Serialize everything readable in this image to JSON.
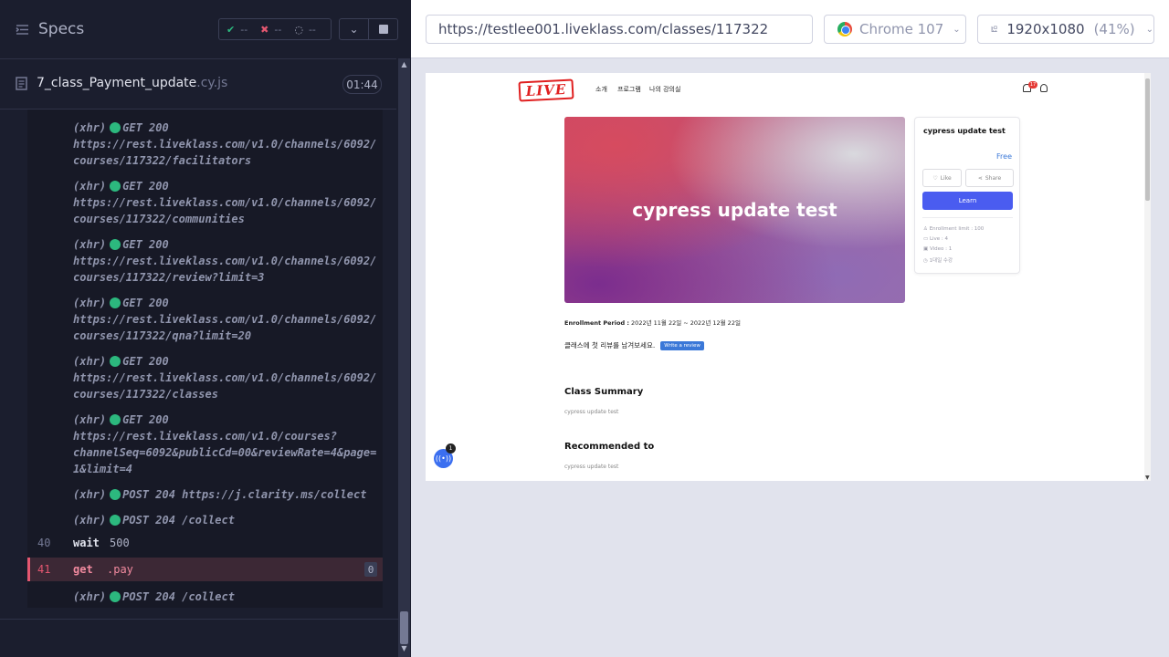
{
  "reporter": {
    "specs_label": "Specs",
    "stats": {
      "passed": "--",
      "failed": "--",
      "pending": "--"
    },
    "spec_file": {
      "name": "7_class_Payment_update",
      "ext": ".cy.js",
      "duration": "01:44"
    },
    "log_entries": [
      {
        "type": "(xhr)",
        "text": "GET 200",
        "url": "https://rest.liveklass.com/v1.0/channels/6092/courses/117322/facilitators",
        "lines": [
          "https://rest.liveklass.com/v1.0/channels/6092/",
          "courses/117322/facilitators"
        ]
      },
      {
        "type": "(xhr)",
        "text": "GET 200",
        "url": "https://rest.liveklass.com/v1.0/channels/6092/courses/117322/communities",
        "lines": [
          "https://rest.liveklass.com/v1.0/channels/6092/",
          "courses/117322/communities"
        ]
      },
      {
        "type": "(xhr)",
        "text": "GET 200",
        "url": "https://rest.liveklass.com/v1.0/channels/6092/courses/117322/review?limit=3",
        "lines": [
          "https://rest.liveklass.com/v1.0/channels/6092/",
          "courses/117322/review?limit=3"
        ]
      },
      {
        "type": "(xhr)",
        "text": "GET 200",
        "url": "https://rest.liveklass.com/v1.0/channels/6092/courses/117322/qna?limit=20",
        "lines": [
          "https://rest.liveklass.com/v1.0/channels/6092/",
          "courses/117322/qna?limit=20"
        ]
      },
      {
        "type": "(xhr)",
        "text": "GET 200",
        "url": "https://rest.liveklass.com/v1.0/channels/6092/courses/117322/classes",
        "lines": [
          "https://rest.liveklass.com/v1.0/channels/6092/",
          "courses/117322/classes"
        ]
      },
      {
        "type": "(xhr)",
        "text": "GET 200",
        "url": "https://rest.liveklass.com/v1.0/courses?channelSeq=6092&publicCd=00&reviewRate=4&page=1&limit=4",
        "lines": [
          "https://rest.liveklass.com/v1.0/courses?",
          "channelSeq=6092&publicCd=00&reviewRate=4&page=",
          "1&limit=4"
        ]
      },
      {
        "type": "(xhr)",
        "text": "POST 204 https://j.clarity.ms/collect"
      },
      {
        "type": "(xhr)",
        "text": "POST 204 /collect"
      }
    ],
    "commands": [
      {
        "num": "40",
        "name": "wait",
        "arg": "500"
      },
      {
        "num": "41",
        "name": "get",
        "arg": ".pay",
        "badge": "0"
      }
    ],
    "last_entry": {
      "type": "(xhr)",
      "text": "POST 204 /collect"
    }
  },
  "preview": {
    "url": "https://testlee001.liveklass.com/classes/117322",
    "browser": "Chrome 107",
    "viewport": "1920x1080",
    "zoom": "(41%)"
  },
  "aut": {
    "logo": "LIVE",
    "nav": [
      "소개",
      "프로그램",
      "나의 강의실"
    ],
    "notif_count": "17",
    "hero_title": "cypress update test",
    "card": {
      "title": "cypress update test",
      "price": "Free",
      "like": "Like",
      "share": "Share",
      "learn": "Learn",
      "meta": [
        "Enrollment limit : 100",
        "Live : 4",
        "Video : 1",
        "1대일 수강"
      ]
    },
    "enroll_label": "Enrollment Period :",
    "enroll_value": "2022년 11월 22일 ~ 2022년 12월 22일",
    "review_prompt": "클래스에 첫 리뷰를 남겨보세요.",
    "write_review": "Write a review",
    "summary_title": "Class Summary",
    "summary_text": "cypress update test",
    "recommend_title": "Recommended to",
    "recommend_text": "cypress update test",
    "fab_count": "1"
  }
}
